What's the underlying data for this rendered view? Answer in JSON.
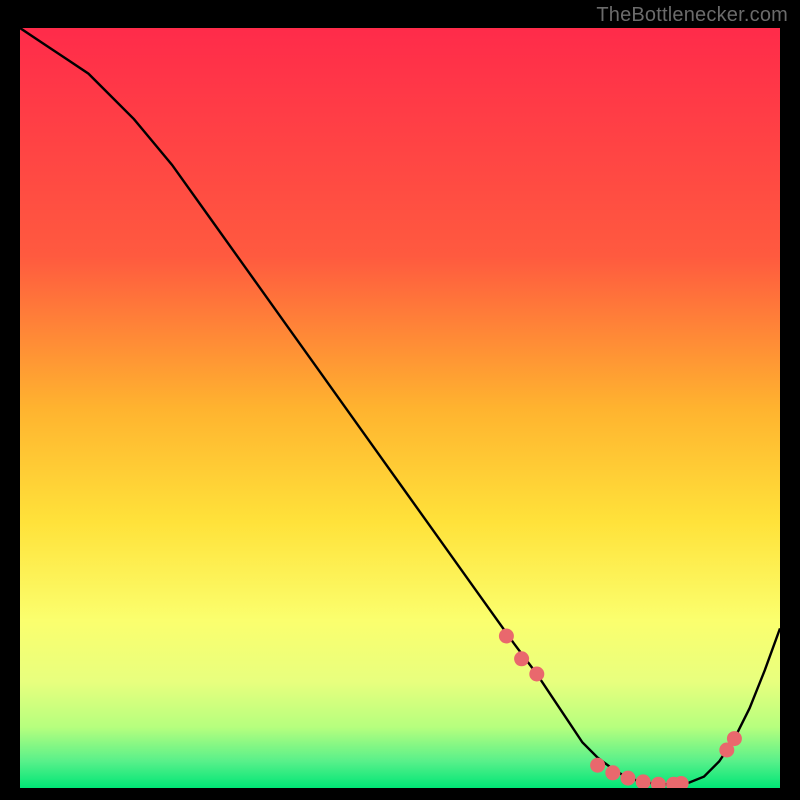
{
  "attribution": "TheBottlenecker.com",
  "colors": {
    "bg_black": "#000000",
    "curve": "#000000",
    "marker": "#e9686d",
    "attribution_text": "#6b6b6b",
    "grad_top": "#ff2b4a",
    "grad_mid1": "#ff8a3a",
    "grad_mid2": "#ffe13a",
    "grad_low1": "#f8ff82",
    "grad_low2": "#c8ff82",
    "grad_green": "#00e676"
  },
  "chart_data": {
    "type": "line",
    "title": "",
    "xlabel": "",
    "ylabel": "",
    "xlim": [
      0,
      100
    ],
    "ylim": [
      0,
      100
    ],
    "series": [
      {
        "name": "curve",
        "x": [
          0,
          3,
          6,
          9,
          12,
          15,
          20,
          25,
          30,
          35,
          40,
          45,
          50,
          55,
          60,
          65,
          68,
          70,
          72,
          74,
          76,
          78,
          80,
          82,
          84,
          86,
          88,
          90,
          92,
          94,
          96,
          98,
          100
        ],
        "y": [
          100,
          98,
          96,
          94,
          91,
          88,
          82,
          75,
          68,
          61,
          54,
          47,
          40,
          33,
          26,
          19,
          15,
          12,
          9,
          6,
          4,
          2.5,
          1.3,
          0.8,
          0.5,
          0.5,
          0.7,
          1.5,
          3.5,
          6.5,
          10.5,
          15.5,
          21
        ]
      }
    ],
    "markers": {
      "x": [
        64,
        66,
        68,
        76,
        78,
        80,
        82,
        84,
        86,
        87,
        93,
        94
      ],
      "y": [
        20,
        17,
        15,
        3,
        2,
        1.3,
        0.8,
        0.5,
        0.5,
        0.6,
        5.0,
        6.5
      ]
    },
    "background_gradient_stops": [
      {
        "offset": 0.0,
        "color": "#ff2b4a"
      },
      {
        "offset": 0.3,
        "color": "#ff5a3f"
      },
      {
        "offset": 0.5,
        "color": "#ffb32f"
      },
      {
        "offset": 0.65,
        "color": "#ffe23a"
      },
      {
        "offset": 0.78,
        "color": "#fbff6e"
      },
      {
        "offset": 0.86,
        "color": "#e8ff7e"
      },
      {
        "offset": 0.92,
        "color": "#b6ff7e"
      },
      {
        "offset": 0.965,
        "color": "#58f08a"
      },
      {
        "offset": 1.0,
        "color": "#00e676"
      }
    ]
  }
}
